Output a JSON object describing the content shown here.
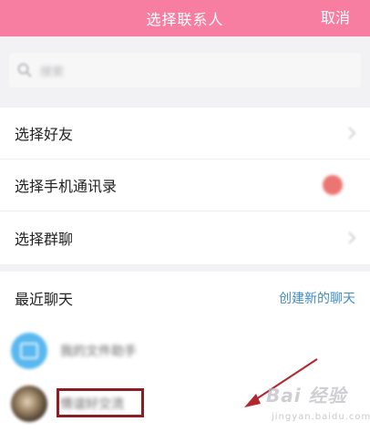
{
  "header": {
    "title": "选择联系人",
    "cancel_label": "取消"
  },
  "search": {
    "placeholder": "搜索"
  },
  "menu": {
    "items": [
      {
        "label": "选择好友"
      },
      {
        "label": "选择手机通讯录"
      },
      {
        "label": "选择群聊"
      }
    ]
  },
  "recent": {
    "title": "最近聊天",
    "create_label": "创建新的聊天",
    "chats": [
      {
        "name": "我的文件助手"
      },
      {
        "name": "情谊好交流"
      }
    ]
  },
  "watermark": {
    "brand": "Bai 经验",
    "url": "jingyan.baidu.com"
  },
  "colors": {
    "header_bg": "#f77ea1",
    "link_blue": "#3f8ec9",
    "toggle_red": "#ec7472",
    "highlight_box": "#8a1e24",
    "annotation_arrow": "#b2272d"
  }
}
